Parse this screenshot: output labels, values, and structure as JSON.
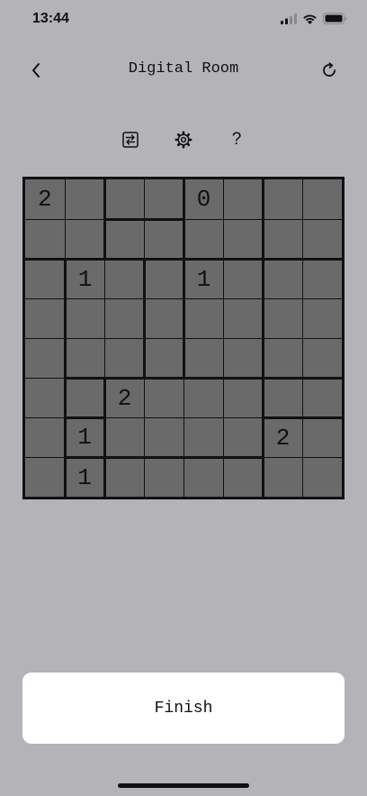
{
  "status_bar": {
    "time": "13:44"
  },
  "nav": {
    "title": "Digital Room"
  },
  "toolbar": {
    "help_label": "?"
  },
  "board": {
    "size": 8,
    "cells": [
      [
        "2",
        "",
        "",
        "",
        "0",
        "",
        "",
        ""
      ],
      [
        "",
        "",
        "",
        "",
        "",
        "",
        "",
        ""
      ],
      [
        "",
        "1",
        "",
        "",
        "1",
        "",
        "",
        ""
      ],
      [
        "",
        "",
        "",
        "",
        "",
        "",
        "",
        ""
      ],
      [
        "",
        "",
        "",
        "",
        "",
        "",
        "",
        ""
      ],
      [
        "",
        "",
        "2",
        "",
        "",
        "",
        "",
        ""
      ],
      [
        "",
        "1",
        "",
        "",
        "",
        "",
        "2",
        ""
      ],
      [
        "",
        "1",
        "",
        "",
        "",
        "",
        "",
        ""
      ]
    ],
    "regions": [
      [
        0,
        0,
        1,
        1,
        2,
        2,
        3,
        3
      ],
      [
        0,
        0,
        4,
        4,
        2,
        2,
        3,
        3
      ],
      [
        5,
        6,
        6,
        7,
        8,
        8,
        9,
        9
      ],
      [
        5,
        6,
        6,
        7,
        8,
        8,
        9,
        9
      ],
      [
        5,
        6,
        6,
        7,
        8,
        8,
        9,
        9
      ],
      [
        5,
        10,
        11,
        11,
        11,
        11,
        12,
        12
      ],
      [
        5,
        13,
        11,
        11,
        11,
        11,
        14,
        14
      ],
      [
        5,
        15,
        16,
        16,
        16,
        16,
        14,
        14
      ]
    ]
  },
  "actions": {
    "finish_label": "Finish"
  }
}
